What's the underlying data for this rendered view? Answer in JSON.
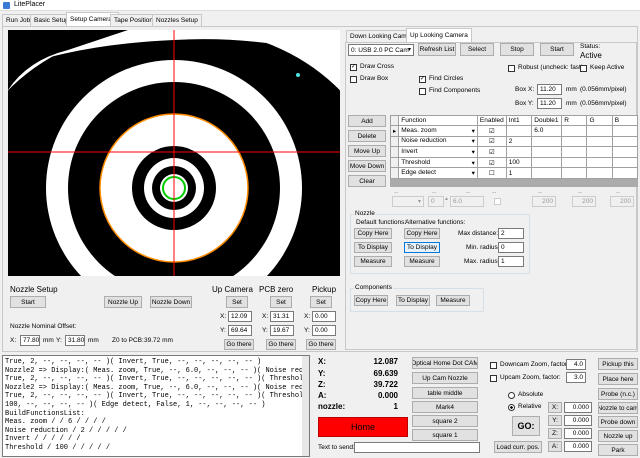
{
  "window": {
    "title": "LitePlacer"
  },
  "tabs": [
    "Run Job",
    "Basic Setup",
    "Setup Cameras",
    "Tape Positions",
    "Nozzles Setup"
  ],
  "camera_tabs": [
    "Down Looking Camera",
    "Up Looking Camera"
  ],
  "camera_toolbar": {
    "camera_select": "0: USB 2.0 PC Cam",
    "refresh": "Refresh List",
    "select": "Select",
    "stop": "Stop",
    "start": "Start",
    "status_label": "Status:",
    "status_value": "Active"
  },
  "options": {
    "draw_cross": "Draw Cross",
    "draw_box": "Draw Box",
    "find_circles": "Find Circles",
    "find_components": "Find Components",
    "robust": "Robust (uncheck: fast)",
    "keep_active": "Keep Active",
    "box_x_label": "Box X:",
    "box_x_value": "11.20",
    "box_x_unit": "mm",
    "box_x_px": "(0.056mm/pixel)",
    "box_y_label": "Box Y:",
    "box_y_value": "11.20",
    "box_y_unit": "mm",
    "box_y_px": "(0.056mm/pixel)"
  },
  "list_buttons": [
    "Add",
    "Delete",
    "Move Up",
    "Move Down",
    "Clear"
  ],
  "functions_table": {
    "headers": [
      "Function",
      "Enabled",
      "Int1",
      "Double1",
      "R",
      "G",
      "B"
    ],
    "rows": [
      {
        "fn": "Meas. zoom",
        "int1": "",
        "double1": "6.0"
      },
      {
        "fn": "Noise reduction",
        "int1": "2",
        "double1": ""
      },
      {
        "fn": "Invert",
        "int1": "",
        "double1": ""
      },
      {
        "fn": "Threshold",
        "int1": "100",
        "double1": ""
      },
      {
        "fn": "Edge detect",
        "int1": "1",
        "double1": ""
      }
    ],
    "dashes": [
      "--",
      "--",
      "--",
      "--",
      "--",
      "--",
      "--"
    ],
    "edit_values": [
      "0",
      "6.0",
      "200",
      "200",
      "200"
    ]
  },
  "nozzle_group": {
    "title": "Nozzle",
    "default_label": "Default functions:",
    "alt_label": "Alternative functions:",
    "copy_here": "Copy Here",
    "to_display": "To Display",
    "measure": "Measure",
    "max_distance_label": "Max distance:",
    "max_distance": "2",
    "min_radius_label": "Min. radius:",
    "min_radius": "0",
    "max_radius_label": "Max. radius:",
    "max_radius": "1"
  },
  "components_group": {
    "title": "Components",
    "copy_here": "Copy Here",
    "to_display": "To Display",
    "measure": "Measure"
  },
  "nozzle_setup": {
    "title": "Nozzle Setup",
    "start": "Start",
    "nozzle_up": "Nozzle Up",
    "nozzle_down": "Nozzle Down",
    "offset_label": "Nozzle Nominal Offset:",
    "x_label": "X:",
    "x_value": "77.80",
    "x_unit": "mm",
    "y_label": "Y:",
    "y_value": "31.80",
    "y_unit": "mm",
    "z0_label": "Z0 to PCB:",
    "z0_value": "39.72 mm"
  },
  "positions": {
    "up_camera": "Up Camera",
    "pcb_zero": "PCB zero",
    "pickup": "Pickup",
    "set": "Set",
    "go_there": "Go there",
    "x_label": "X:",
    "y_label": "Y:",
    "up_x": "12.09",
    "up_y": "69.64",
    "pcb_x": "31.31",
    "pcb_y": "19.67",
    "pick_x": "0.00",
    "pick_y": "0.00"
  },
  "console": [
    "True, 2, --, --, --, -- )( Invert, True, --, --, --, --, -- )",
    "Nozzle2 => Display:( Meas. zoom, True, --, 6.0, --, --, -- )( Noise reduction,",
    "True, 2, --, --, --, -- )( Invert, True, --, --, --, --, -- )( Threshold, True,",
    "Nozzle2 => Display:( Meas. zoom, True, --, 6.0, --, --, -- )( Noise reduction,",
    "True, 2, --, --, --, -- )( Invert, True, --, --, --, --, -- )( Threshold, True,",
    "100, --, --, --, -- )( Edge detect, False, 1, --, --, --, -- )",
    "BuildFunctionsList:",
    "Meas. zoom /  / 6 /  /  /  /",
    "Noise reduction / 2 /  /  /  /  /",
    "Invert /  /  /  /  /  /",
    "Threshold / 100 /  /  /  /  /"
  ],
  "dro": {
    "x_label": "X:",
    "x": "12.087",
    "y_label": "Y:",
    "y": "69.639",
    "z_label": "Z:",
    "z": "39.722",
    "a_label": "A:",
    "a": "0.000",
    "nozzle_label": "nozzle:",
    "nozzle": "1",
    "home": "Home",
    "send_label": "Text to send:"
  },
  "action_buttons": [
    "Optical Home Dot CAM",
    "Up Cam Nozzle",
    "table middle",
    "Mark4",
    "square 2",
    "square 1",
    "Load curr. pos."
  ],
  "zoom": {
    "down_label": "Downcam Zoom, factor:",
    "down_value": "4.0",
    "up_label": "Upcam Zoom, factor:",
    "up_value": "3.0"
  },
  "jog": {
    "absolute": "Absolute",
    "relative": "Relative",
    "go": "GO:",
    "x_label": "X:",
    "y_label": "Y:",
    "z_label": "Z:",
    "a_label": "A:",
    "x": "0.000",
    "y": "0.000",
    "z": "0.000",
    "a": "0.000"
  },
  "right_buttons": [
    "Pickup this",
    "Place here",
    "Probe (n.c.)",
    "Nozzle to cam",
    "Probe down",
    "Nozzle up",
    "Park"
  ],
  "colors": {
    "home_red": "#ff0000",
    "cross_red": "#ff0000",
    "ring_orange": "#ff8c00",
    "ring_green": "#00cc00"
  }
}
